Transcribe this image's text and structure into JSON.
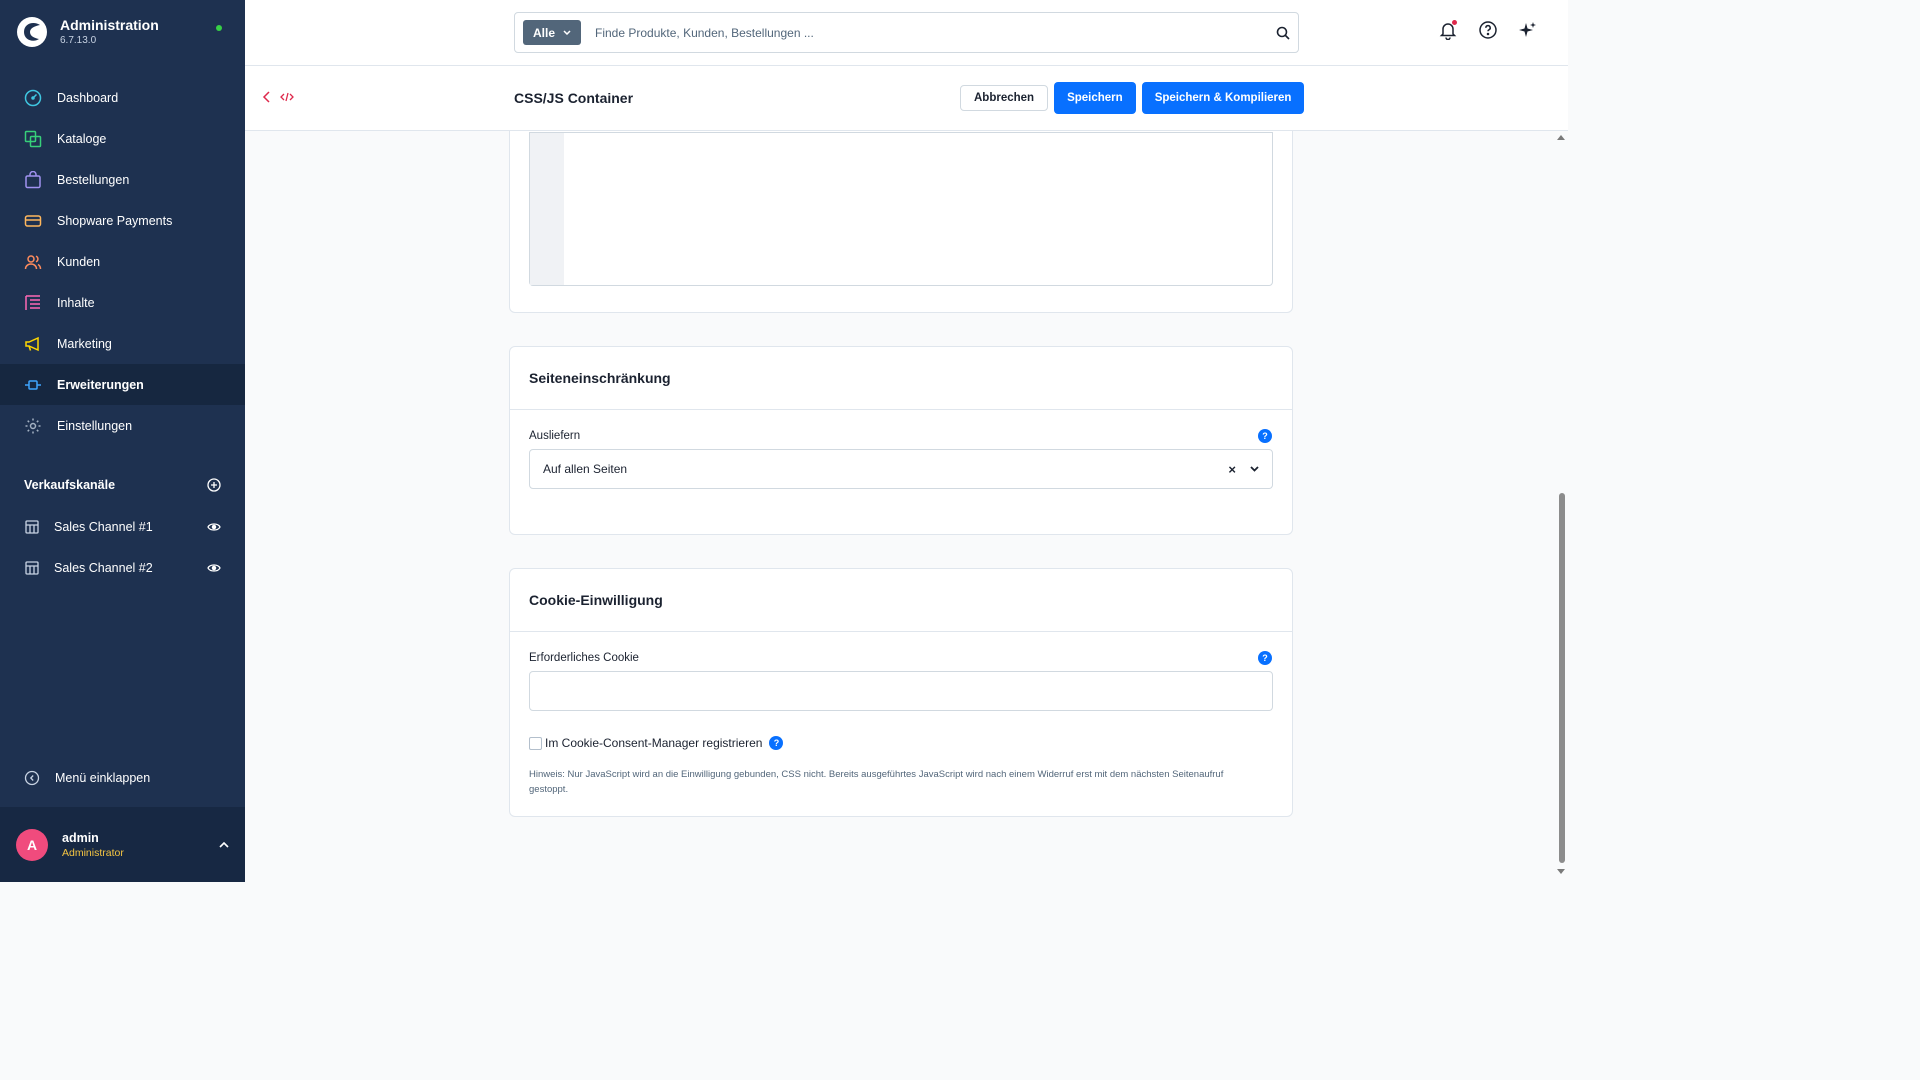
{
  "app": {
    "title": "Administration",
    "version": "6.7.13.0"
  },
  "nav": {
    "items": [
      {
        "label": "Dashboard",
        "icon": "dashboard-icon"
      },
      {
        "label": "Kataloge",
        "icon": "catalog-icon"
      },
      {
        "label": "Bestellungen",
        "icon": "shopping-bag-icon"
      },
      {
        "label": "Shopware Payments",
        "icon": "payments-icon"
      },
      {
        "label": "Kunden",
        "icon": "users-icon"
      },
      {
        "label": "Inhalte",
        "icon": "content-icon"
      },
      {
        "label": "Marketing",
        "icon": "megaphone-icon"
      },
      {
        "label": "Erweiterungen",
        "icon": "plug-icon",
        "active": true
      },
      {
        "label": "Einstellungen",
        "icon": "gear-icon"
      }
    ],
    "sales_channels_label": "Verkaufskanäle",
    "sales_channels": [
      {
        "label": "Sales Channel #1"
      },
      {
        "label": "Sales Channel #2"
      }
    ],
    "collapse_label": "Menü einklappen"
  },
  "user": {
    "initial": "A",
    "name": "admin",
    "role": "Administrator"
  },
  "search": {
    "type": "Alle",
    "placeholder": "Finde Produkte, Kunden, Bestellungen ..."
  },
  "smartbar": {
    "title": "CSS/JS Container",
    "cancel_label": "Abbrechen",
    "save_label": "Speichern",
    "save_compile_label": "Speichern & Kompilieren"
  },
  "page_restriction": {
    "title": "Seiteneinschränkung",
    "deliver_label": "Ausliefern",
    "deliver_value": "Auf allen Seiten",
    "help": "?"
  },
  "cookie_consent": {
    "title": "Cookie-Einwilligung",
    "required_cookie_label": "Erforderliches Cookie",
    "required_cookie_value": "",
    "register_label": "Im Cookie-Consent-Manager registrieren",
    "hint": "Hinweis: Nur JavaScript wird an die Einwilligung gebunden, CSS nicht. Bereits ausgeführtes JavaScript wird nach einem Widerruf erst mit dem nächsten Seitenaufruf gestoppt.",
    "help": "?"
  },
  "colors": {
    "sidebar_bg": "#1e3150",
    "primary": "#0870ff",
    "accent_red": "#de294c",
    "status_green": "#37d046"
  }
}
